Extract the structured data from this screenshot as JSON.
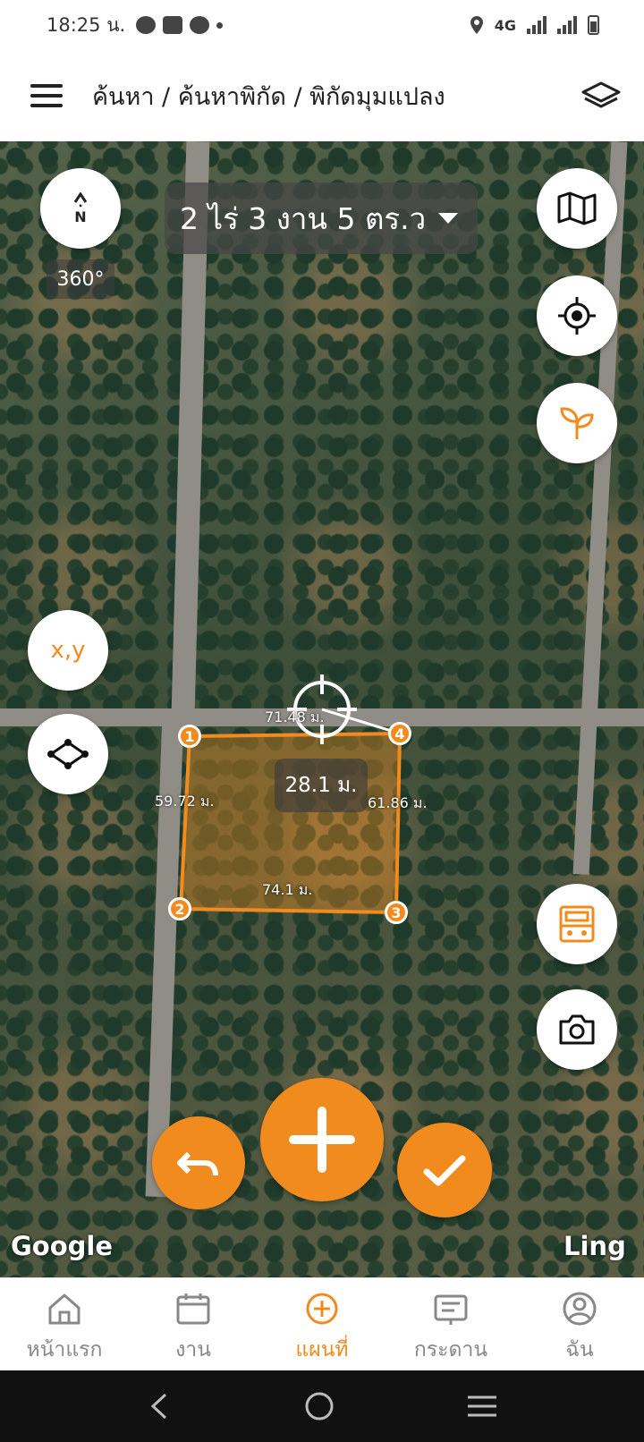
{
  "status": {
    "time": "18:25 น.",
    "network": "4G"
  },
  "header": {
    "breadcrumb": "ค้นหา / ค้นหาพิกัด / พิกัดมุมแปลง"
  },
  "map": {
    "compass_label": "N",
    "rotation": "360°",
    "area_summary": "2 ไร่ 3 งาน 5 ตร.ว",
    "xy_label": "x,y",
    "center_distance": "28.1 ม.",
    "google_label": "Google",
    "corner_label": "Ling",
    "vertices": [
      "1",
      "2",
      "3",
      "4"
    ],
    "edges": {
      "top": "71.48 ม.",
      "left": "59.72 ม.",
      "right": "61.86 ม.",
      "bottom": "74.1 ม."
    },
    "accent_color": "#f28b1e"
  },
  "bottom_nav": {
    "items": [
      {
        "label": "หน้าแรก",
        "icon": "home-icon"
      },
      {
        "label": "งาน",
        "icon": "calendar-icon"
      },
      {
        "label": "แผนที่",
        "icon": "plus-circle-icon"
      },
      {
        "label": "กระดาน",
        "icon": "board-icon"
      },
      {
        "label": "ฉัน",
        "icon": "user-icon"
      }
    ],
    "active": "แผนที่"
  }
}
